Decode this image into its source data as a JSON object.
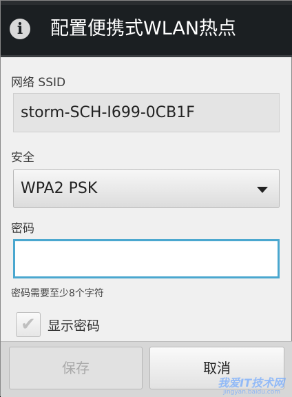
{
  "dialog": {
    "title": "配置便携式WLAN热点",
    "title_icon": "info-icon"
  },
  "ssid": {
    "label": "网络 SSID",
    "value": "storm-SCH-I699-0CB1F"
  },
  "security": {
    "label": "安全",
    "selected": "WPA2 PSK",
    "dropdown_icon": "chevron-down-icon"
  },
  "password": {
    "label": "密码",
    "value": "",
    "hint": "密码需要至少8个字符"
  },
  "show_password": {
    "label": "显示密码",
    "checked": true
  },
  "buttons": {
    "save": "保存",
    "cancel": "取消"
  },
  "watermark": {
    "text": "我爱IT技术网",
    "sub": "jingyan.baidu.com"
  },
  "colors": {
    "titlebar": "#1b1f22",
    "focus": "#4aa7cf",
    "background": "#f0f0f0"
  }
}
